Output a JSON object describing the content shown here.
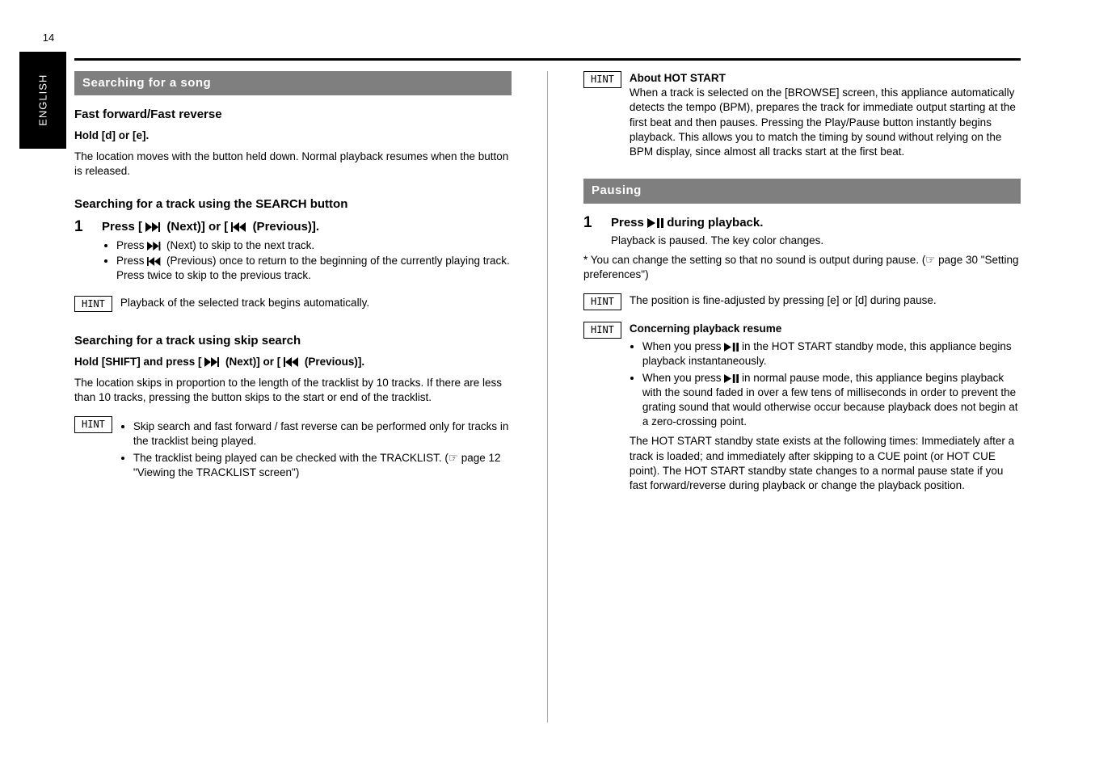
{
  "pageNumber": "14",
  "verticalTab": "ENGLISH",
  "left": {
    "titleBar": "Searching for a song",
    "h1": "Fast forward/Fast reverse",
    "p1": "Hold [d] or [e].",
    "p1sub": "The location moves with the button held down. Normal playback resumes when the button is released.",
    "h2": "Searching for a track using the SEARCH button",
    "step1": {
      "line1": "Press [",
      "line2": " (Next)] or [",
      "line3": " (Previous)].",
      "items": [
        {
          "pre": "Press ",
          "post": " (Next) to skip to the next track."
        },
        {
          "pre": "Press ",
          "post": " (Previous) once to return to the beginning of the currently playing track. Press twice to skip to the previous track."
        }
      ]
    },
    "hint1": {
      "label": "HINT",
      "text": "Playback of the selected track begins automatically."
    },
    "h3": "Searching for a track using skip search",
    "p3pre": "Hold [SHIFT] and press [",
    "p3mid": "(Next)] or [",
    "p3end": "(Previous)].",
    "p3body": "The location skips in proportion to the length of the tracklist by 10 tracks. If there are less than 10 tracks, pressing the button skips to the start or end of the tracklist.",
    "hint2": {
      "label": "HINT",
      "items": [
        "Skip search and fast forward / fast reverse can be performed only for tracks in the tracklist being played.",
        "The tracklist being played can be checked with the TRACKLIST. (☞ page 12 \"Viewing the TRACKLIST screen\")"
      ]
    }
  },
  "right": {
    "topHint": {
      "label": "HINT",
      "bold": "About HOT START",
      "text": "When a track is selected on the [BROWSE] screen, this appliance automatically detects the tempo (BPM), prepares the track for immediate output starting at the first beat and then pauses. Pressing the Play/Pause button instantly begins playback. This allows you to match the timing by sound without relying on the BPM display, since almost all tracks start at the first beat."
    },
    "titleBar": "Pausing",
    "stepA": {
      "pre": "Press ",
      "post": " during playback.",
      "sub": "Playback is paused. The key color changes."
    },
    "note": "* You can change the setting so that no sound is output during pause. (☞ page 30 \"Setting preferences\")",
    "hintB": {
      "label": "HINT",
      "text": "The position is fine-adjusted by pressing [e] or [d] during pause."
    },
    "hintC": {
      "label": "HINT",
      "bold": "Concerning playback resume",
      "line1pre": "When you press ",
      "line1post": " in the HOT START standby mode, this appliance begins playback instantaneously.",
      "line2pre": "When you press ",
      "line2post": " in normal pause mode, this appliance begins playback with the sound faded in over a few tens of milliseconds in order to prevent the grating sound that would otherwise occur because playback does not begin at a zero-crossing point.",
      "tail": "The HOT START standby state exists at the following times: Immediately after a track is loaded; and immediately after skipping to a CUE point (or HOT CUE point). The HOT START standby state changes to a normal pause state if you fast forward/reverse during playback or change the playback position."
    }
  }
}
